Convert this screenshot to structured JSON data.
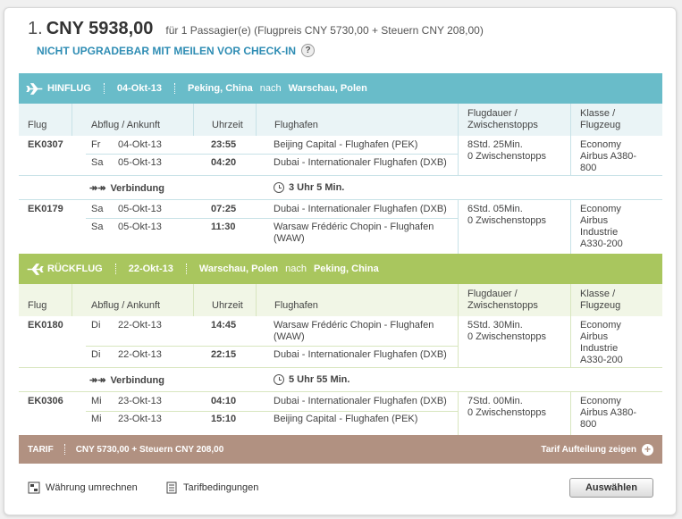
{
  "summary": {
    "index": "1.",
    "price": "CNY 5938,00",
    "passengers": "für 1 Passagier(e) (Flugpreis CNY 5730,00 + Steuern CNY 208,00)",
    "upgrade_note": "NICHT UPGRADEBAR MIT MEILEN VOR CHECK-IN",
    "help_symbol": "?"
  },
  "columns": {
    "flight": "Flug",
    "depart_arrive": "Abflug / Ankunft",
    "time": "Uhrzeit",
    "airport": "Flughafen",
    "duration_1": "Flugdauer /",
    "duration_2": "Zwischenstopps",
    "class_1": "Klasse /",
    "class_2": "Flugzeug"
  },
  "outbound": {
    "label": "HINFLUG",
    "date": "04-Okt-13",
    "from": "Peking, China",
    "to_word": "nach",
    "to": "Warschau, Polen",
    "color": "#69bcc9",
    "legs": [
      {
        "flight": "EK0307",
        "rows": [
          {
            "day": "Fr",
            "date": "04-Okt-13",
            "time": "23:55",
            "airport": "Beijing Capital - Flughafen (PEK)"
          },
          {
            "day": "Sa",
            "date": "05-Okt-13",
            "time": "04:20",
            "airport": "Dubai - Internationaler Flughafen (DXB)"
          }
        ],
        "duration": "8Std. 25Min.",
        "stops": "0 Zwischenstopps",
        "class_lines": [
          "Economy",
          "Airbus A380-",
          "800"
        ]
      },
      {
        "flight": "EK0179",
        "rows": [
          {
            "day": "Sa",
            "date": "05-Okt-13",
            "time": "07:25",
            "airport": "Dubai - Internationaler Flughafen (DXB)"
          },
          {
            "day": "Sa",
            "date": "05-Okt-13",
            "time": "11:30",
            "airport_1": "Warsaw Frédéric Chopin - Flughafen",
            "airport_2": "(WAW)"
          }
        ],
        "duration": "6Std. 05Min.",
        "stops": "0 Zwischenstopps",
        "class_lines": [
          "Economy",
          "Airbus",
          "Industrie",
          "A330-200"
        ]
      }
    ],
    "connection_label": "Verbindung",
    "connection_time": "3 Uhr 5 Min."
  },
  "return": {
    "label": "RÜCKFLUG",
    "date": "22-Okt-13",
    "from": "Warschau, Polen",
    "to_word": "nach",
    "to": "Peking, China",
    "color": "#a9c65e",
    "legs": [
      {
        "flight": "EK0180",
        "rows": [
          {
            "day": "Di",
            "date": "22-Okt-13",
            "time": "14:45",
            "airport_1": "Warsaw Frédéric Chopin - Flughafen",
            "airport_2": "(WAW)"
          },
          {
            "day": "Di",
            "date": "22-Okt-13",
            "time": "22:15",
            "airport": "Dubai - Internationaler Flughafen (DXB)"
          }
        ],
        "duration": "5Std. 30Min.",
        "stops": "0 Zwischenstopps",
        "class_lines": [
          "Economy",
          "Airbus",
          "Industrie",
          "A330-200"
        ]
      },
      {
        "flight": "EK0306",
        "rows": [
          {
            "day": "Mi",
            "date": "23-Okt-13",
            "time": "04:10",
            "airport": "Dubai - Internationaler Flughafen (DXB)"
          },
          {
            "day": "Mi",
            "date": "23-Okt-13",
            "time": "15:10",
            "airport": "Beijing Capital - Flughafen (PEK)"
          }
        ],
        "duration": "7Std. 00Min.",
        "stops": "0 Zwischenstopps",
        "class_lines": [
          "Economy",
          "Airbus A380-",
          "800"
        ]
      }
    ],
    "connection_label": "Verbindung",
    "connection_time": "5 Uhr 55 Min."
  },
  "tarif": {
    "label": "TARIF",
    "breakdown": "CNY 5730,00 + Steuern CNY 208,00",
    "details_link": "Tarif Aufteilung zeigen",
    "color": "#b19181"
  },
  "footer": {
    "currency_link": "Währung umrechnen",
    "terms_link": "Tarifbedingungen",
    "select_button": "Auswählen"
  }
}
